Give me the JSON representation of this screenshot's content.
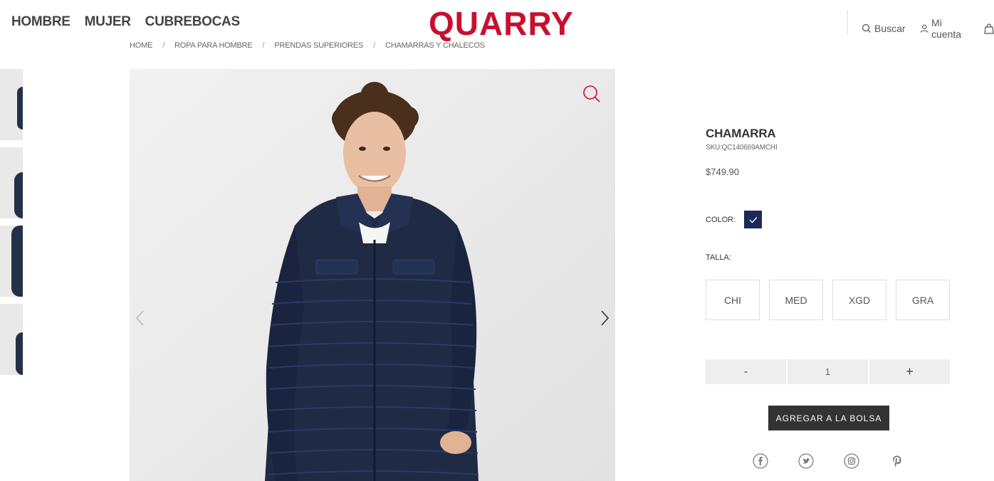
{
  "header": {
    "nav": [
      "HOMBRE",
      "MUJER",
      "CUBREBOCAS"
    ],
    "logo": "QUARRY",
    "search_label": "Buscar",
    "account_label": "Mi cuenta"
  },
  "breadcrumb": [
    "HOME",
    "ROPA PARA HOMBRE",
    "PRENDAS SUPERIORES",
    "CHAMARRAS Y CHALECOS"
  ],
  "product": {
    "title": "CHAMARRA",
    "sku": "SKU:QC140669AMCHI",
    "price": "$749.90",
    "color_label": "COLOR:",
    "selected_color": "#1d2a57",
    "size_label": "TALLA:",
    "sizes": [
      "CHI",
      "MED",
      "XGD",
      "GRA"
    ],
    "quantity": "1",
    "minus_label": "-",
    "plus_label": "+",
    "add_to_bag_label": "AGREGAR A LA BOLSA"
  },
  "icons": {
    "search": "search-icon",
    "account": "user-icon",
    "bag": "bag-icon",
    "zoom": "zoom-icon",
    "social": [
      "facebook-icon",
      "twitter-icon",
      "instagram-icon",
      "pinterest-icon"
    ]
  },
  "colors": {
    "brand": "#c8102e",
    "swatch_navy": "#1d2a57",
    "button_dark": "#333333"
  }
}
